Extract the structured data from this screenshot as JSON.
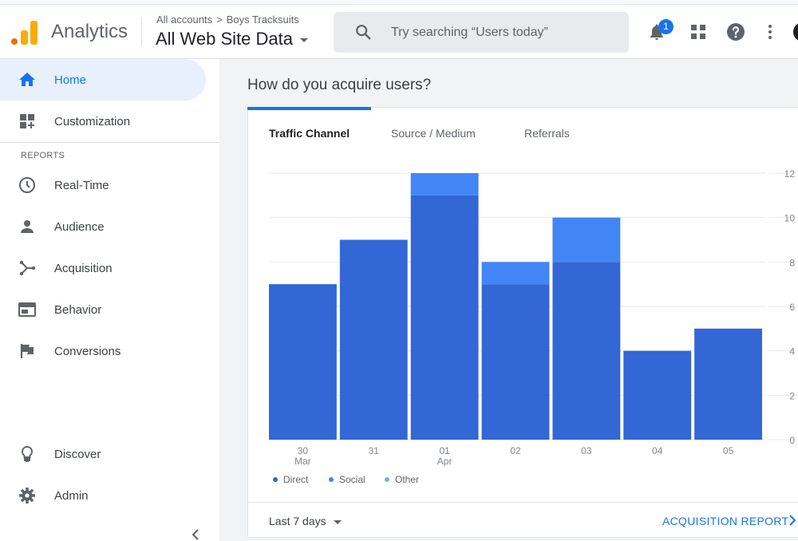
{
  "app": {
    "name": "Analytics"
  },
  "header": {
    "breadcrumb_root": "All accounts",
    "breadcrumb_account": "Boys Tracksuits",
    "view_name": "All Web Site Data",
    "search_placeholder": "Try searching “Users today”",
    "notification_count": "1"
  },
  "sidebar": {
    "items": [
      {
        "label": "Home",
        "icon": "home-icon"
      },
      {
        "label": "Customization",
        "icon": "customization-icon"
      },
      {
        "label": "Real-Time",
        "icon": "clock-icon"
      },
      {
        "label": "Audience",
        "icon": "person-icon"
      },
      {
        "label": "Acquisition",
        "icon": "acquisition-icon"
      },
      {
        "label": "Behavior",
        "icon": "behavior-icon"
      },
      {
        "label": "Conversions",
        "icon": "flag-icon"
      },
      {
        "label": "Discover",
        "icon": "lightbulb-icon"
      },
      {
        "label": "Admin",
        "icon": "gear-icon"
      }
    ],
    "section_label": "REPORTS"
  },
  "main": {
    "heading": "How do you acquire users?",
    "tabs": [
      "Traffic Channel",
      "Source / Medium",
      "Referrals"
    ],
    "date_range": "Last 7 days",
    "report_link": "ACQUISITION REPORT"
  },
  "colors": {
    "direct": "#3367d6",
    "social": "#4285f4",
    "other": "#7baaf7",
    "accent": "#1a73e8"
  },
  "chart_data": {
    "type": "bar",
    "stacked": true,
    "categories": [
      "30 Mar",
      "31",
      "01 Apr",
      "02",
      "03",
      "04",
      "05"
    ],
    "tick_labels": [
      [
        "30",
        "Mar"
      ],
      [
        "31",
        ""
      ],
      [
        "01",
        "Apr"
      ],
      [
        "02",
        ""
      ],
      [
        "03",
        ""
      ],
      [
        "04",
        ""
      ],
      [
        "05",
        ""
      ]
    ],
    "series": [
      {
        "name": "Direct",
        "values": [
          7,
          9,
          11,
          7,
          8,
          4,
          5
        ]
      },
      {
        "name": "Social",
        "values": [
          0,
          0,
          1,
          1,
          2,
          0,
          0
        ]
      },
      {
        "name": "Other",
        "values": [
          0,
          0,
          0,
          0,
          0,
          0,
          0
        ]
      }
    ],
    "ylim": [
      0,
      12
    ],
    "yticks": [
      0,
      2,
      4,
      6,
      8,
      10,
      12
    ],
    "legend_position": "bottom-left",
    "grid": true
  }
}
